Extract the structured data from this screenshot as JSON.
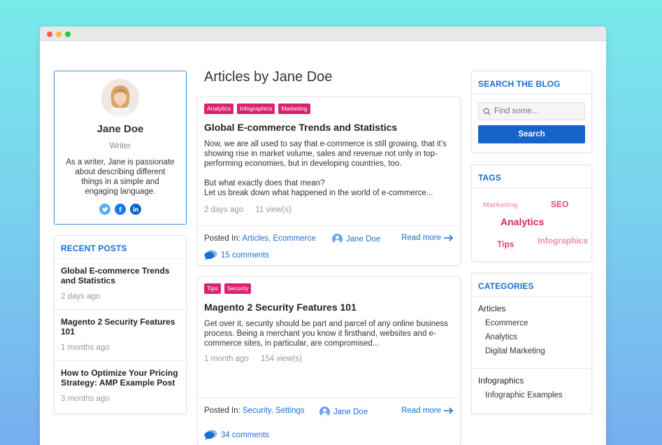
{
  "author": {
    "name": "Jane Doe",
    "role": "Writer",
    "bio": "As a writer, Jane is passionate about describing different things in a simple and engaging language.",
    "socials": [
      "twitter-icon",
      "facebook-icon",
      "linkedin-icon"
    ]
  },
  "recent_posts": {
    "title": "RECENT POSTS",
    "items": [
      {
        "title": "Global E-commerce Trends and Statistics",
        "date": "2 days ago"
      },
      {
        "title": "Magento 2 Security Features 101",
        "date": "1 months ago"
      },
      {
        "title": "How to Optimize Your Pricing Strategy: AMP Example Post",
        "date": "3 months ago"
      }
    ]
  },
  "main": {
    "page_title": "Articles by Jane Doe",
    "articles": [
      {
        "tags": [
          "Analytics",
          "Infographics",
          "Marketing"
        ],
        "title": "Global E-commerce Trends and Statistics",
        "excerpt": "Now, we are all used to say that e-commerce is still growing, that it’s showing rise in market volume, sales and revenue not only in top-performing economies, but in developing countries, too.\n\nBut what exactly does that mean?\nLet us break down what happened in the world of e-commerce...",
        "date": "2 days ago",
        "views": "11 view(s)",
        "posted_in_label": "Posted In:",
        "categories": "Articles, Ecommerce",
        "author": "Jane Doe",
        "read_more": "Read more",
        "comments": "15 comments"
      },
      {
        "tags": [
          "Tips",
          "Security"
        ],
        "title": "Magento 2 Security Features 101",
        "excerpt": "Get over it, security should be part and parcel of any online business process. Being a merchant you know it firsthand, websites and e-commerce sites, in particular, are compromised...",
        "date": "1 month ago",
        "views": "154 view(s)",
        "posted_in_label": "Posted In:",
        "categories": "Security, Settings",
        "author": "Jane Doe",
        "read_more": "Read more",
        "comments": "34 comments"
      }
    ]
  },
  "search": {
    "title": "SEARCH THE BLOG",
    "placeholder": "Find some...",
    "button": "Search"
  },
  "tags_widget": {
    "title": "TAGS",
    "tags": [
      {
        "label": "Marketing",
        "color": "#f4a3c4"
      },
      {
        "label": "SEO",
        "color": "#e0427f"
      },
      {
        "label": "Analytics",
        "color": "#d9236f"
      },
      {
        "label": "Tips",
        "color": "#e0427f"
      },
      {
        "label": "Infographics",
        "color": "#f08ab5"
      }
    ]
  },
  "categories": {
    "title": "CATEGORIES",
    "groups": [
      {
        "name": "Articles",
        "children": [
          "Ecommerce",
          "Analytics",
          "Digital Marketing"
        ]
      },
      {
        "name": "Infographics",
        "children": [
          "Infographic Examples"
        ]
      }
    ]
  },
  "colors": {
    "accent": "#1a6fd1",
    "tag": "#d9236f",
    "button": "#1565c9"
  }
}
